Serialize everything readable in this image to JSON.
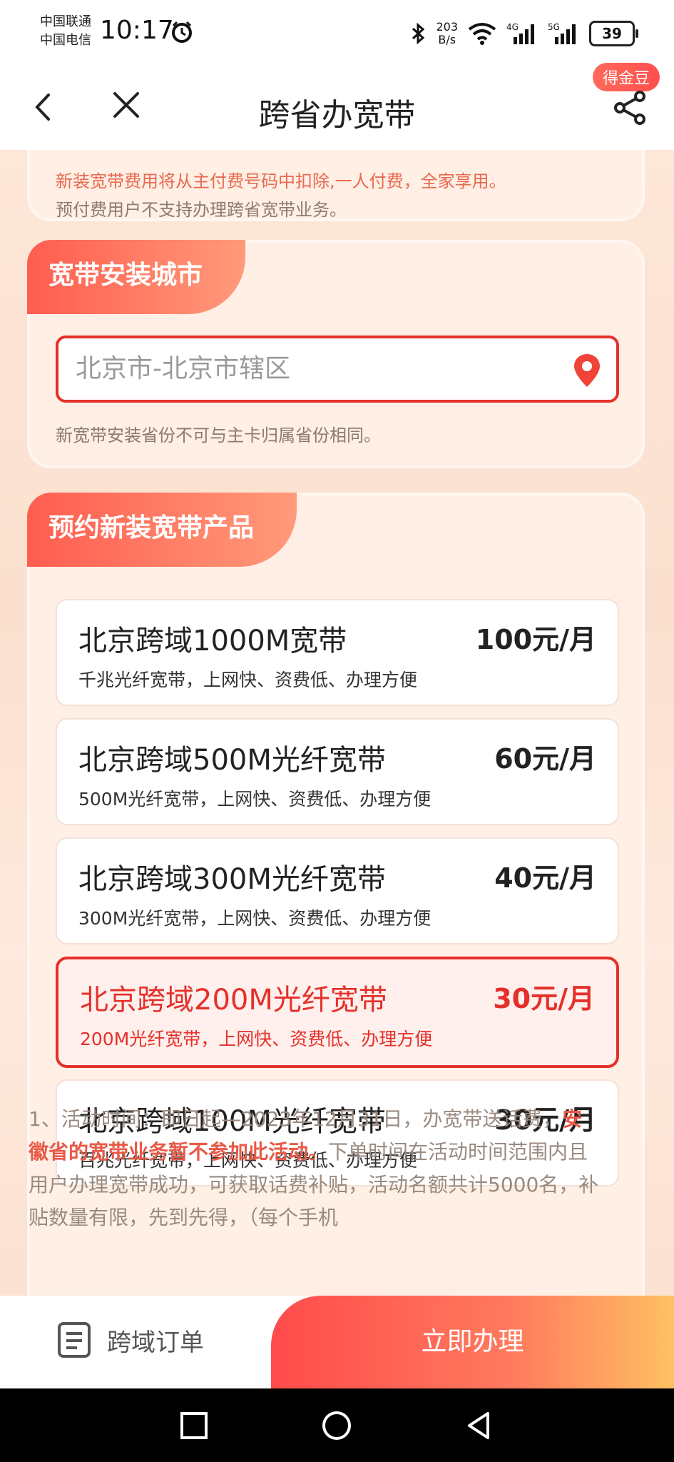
{
  "status_bar": {
    "carrier_1": "中国联通",
    "carrier_2": "中国电信",
    "time": "10:17",
    "speed_value": "203",
    "speed_unit": "B/s",
    "battery": "39"
  },
  "nav": {
    "title": "跨省办宽带",
    "badge": "得金豆"
  },
  "notice": {
    "line1_prefix": "新装宽带费用将从主付费号码中扣除,一人付费，全家享用。",
    "line2": "预付费用户不支持办理跨省宽带业务。"
  },
  "city_section": {
    "title": "宽带安装城市",
    "city_value": "北京市-北京市辖区",
    "hint": "新宽带安装省份不可与主卡归属省份相同。"
  },
  "products_section": {
    "title": "预约新装宽带产品",
    "items": [
      {
        "name": "北京跨域1000M宽带",
        "price": "100元/月",
        "desc": "千兆光纤宽带，上网快、资费低、办理方便"
      },
      {
        "name": "北京跨域500M光纤宽带",
        "price": "60元/月",
        "desc": "500M光纤宽带，上网快、资费低、办理方便"
      },
      {
        "name": "北京跨域300M光纤宽带",
        "price": "40元/月",
        "desc": "300M光纤宽带，上网快、资费低、办理方便"
      },
      {
        "name": "北京跨域200M光纤宽带",
        "price": "30元/月",
        "desc": "200M光纤宽带，上网快、资费低、办理方便"
      },
      {
        "name": "北京跨域100M光纤宽带",
        "price": "30元/月",
        "desc": "百兆光纤宽带，上网快、资费低、办理方便"
      }
    ],
    "selected_index": 3
  },
  "terms": {
    "part1": "1、活动时间：即日起—2023年12月31日，办宽带送话费，",
    "part2_bold": "安徽省的宽带业务暂不参加此活动。",
    "part3": "下单时间在活动时间范围内且用户办理宽带成功，可获取话费补贴，活动名额共计5000名，补贴数量有限，先到先得，（每个手机"
  },
  "bottom_bar": {
    "order_label": "跨域订单",
    "cta_label": "立即办理"
  },
  "colors": {
    "accent_red": "#e5302a",
    "tab_gradient_start": "#ff5d4f",
    "tab_gradient_end": "#ff9a7a",
    "cta_gradient_end": "#ffc063"
  }
}
